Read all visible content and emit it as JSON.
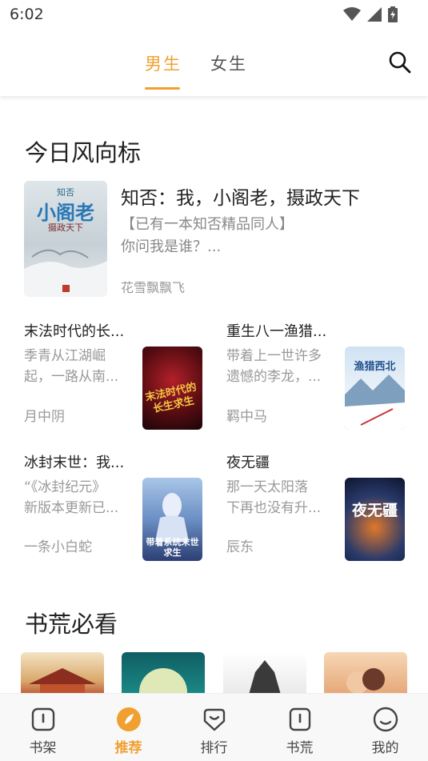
{
  "status_bar": {
    "time": "6:02",
    "icons": [
      "wifi-icon",
      "cellular-icon",
      "battery-charging-icon"
    ]
  },
  "header": {
    "tabs": [
      {
        "label": "男生",
        "active": true
      },
      {
        "label": "女生",
        "active": false
      }
    ],
    "accent_color": "#f0a030",
    "search_icon": "search-icon"
  },
  "section_today": {
    "title": "今日风向标",
    "featured": {
      "title": "知否：我，小阁老，摄政天下",
      "desc_line1": "【已有一本知否精品同人】",
      "desc_line2": "你问我是谁？...",
      "author": "花雪飘飘飞",
      "cover_text": {
        "top": "知否",
        "main": "小阁老",
        "sub": "摄政天下"
      }
    },
    "books": [
      {
        "title": "末法时代的长...",
        "desc_line1": "季青从江湖崛",
        "desc_line2": "起，一路从南...",
        "author": "月中阴",
        "cover_text": "末法时代的长生求生"
      },
      {
        "title": "重生八一渔猎...",
        "desc_line1": "带着上一世许多",
        "desc_line2": "遗憾的李龙，...",
        "author": "羁中马",
        "cover_text": "渔猎西北"
      },
      {
        "title": "冰封末世：我...",
        "desc_line1": "“《冰封纪元》",
        "desc_line2": "新版本更新已...",
        "author": "一条小白蛇",
        "cover_text": "带着系统末世求生"
      },
      {
        "title": "夜无疆",
        "desc_line1": "那一天太阳落",
        "desc_line2": "下再也没有升...",
        "author": "辰东",
        "cover_text": "夜无疆"
      }
    ]
  },
  "section_must_read": {
    "title": "书荒必看"
  },
  "bottom_nav": {
    "items": [
      {
        "label": "书架",
        "icon": "bookshelf-icon",
        "active": false
      },
      {
        "label": "推荐",
        "icon": "recommend-icon",
        "active": true
      },
      {
        "label": "排行",
        "icon": "ranking-icon",
        "active": false
      },
      {
        "label": "书荒",
        "icon": "book-shortage-icon",
        "active": false
      },
      {
        "label": "我的",
        "icon": "profile-icon",
        "active": false
      }
    ]
  }
}
